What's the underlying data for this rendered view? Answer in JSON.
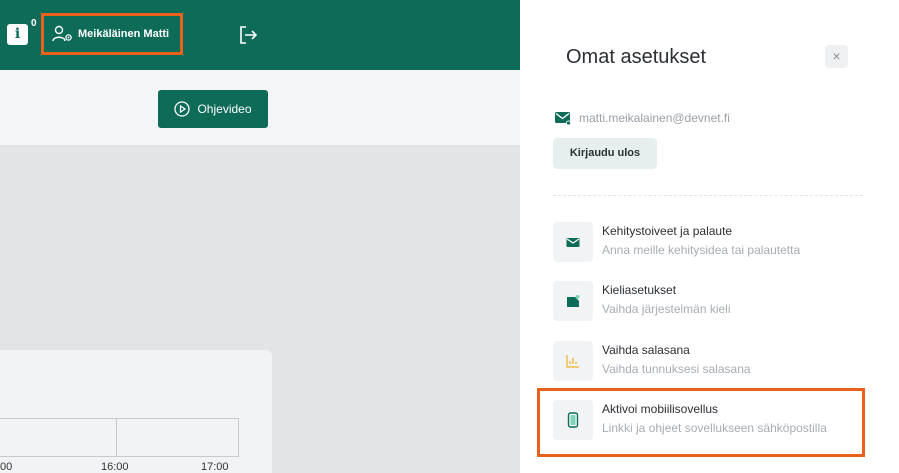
{
  "header": {
    "info_icon": "info-icon",
    "info_count": "0",
    "user_icon": "user-settings-icon",
    "user_name": "Meikäläinen Matti",
    "logout_icon": "logout-icon"
  },
  "toolbar": {
    "video_button_label": "Ohjevideo",
    "video_icon": "play-circle-icon"
  },
  "calendar": {
    "time_labels": [
      "00",
      "16:00",
      "17:00"
    ]
  },
  "settings_panel": {
    "title": "Omat asetukset",
    "close_label": "×",
    "email": "matti.meikalainen@devnet.fi",
    "email_icon": "mail-icon",
    "logout_button_label": "Kirjaudu ulos",
    "items": [
      {
        "title": "Kehitystoiveet ja palaute",
        "subtitle": "Anna meille kehitysidea tai palautetta",
        "icon": "envelope-icon"
      },
      {
        "title": "Kieliasetukset",
        "subtitle": "Vaihda järjestelmän kieli",
        "icon": "language-icon"
      },
      {
        "title": "Vaihda salasana",
        "subtitle": "Vaihda tunnuksesi salasana",
        "icon": "chart-icon"
      },
      {
        "title": "Aktivoi mobiilisovellus",
        "subtitle": "Linkki ja ohjeet sovellukseen sähköpostilla",
        "icon": "phone-icon"
      }
    ]
  },
  "colors": {
    "brand_green": "#0e6b58",
    "highlight_orange": "#e8621b",
    "accent_yellow": "#f0b429"
  }
}
